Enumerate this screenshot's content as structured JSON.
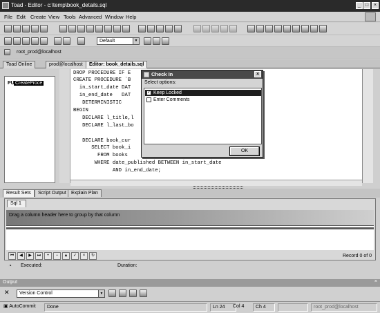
{
  "window": {
    "title": "Toad - Editor - c:\\temp\\book_details.sql",
    "controls": [
      "_",
      "□",
      "×"
    ]
  },
  "menu": {
    "items": [
      "File",
      "Edit",
      "Create",
      "View",
      "Tools",
      "Advanced",
      "Window",
      "Help"
    ],
    "mdi_controls": [
      "_",
      "□",
      "×"
    ]
  },
  "toolbar": {
    "combo_value": "Default"
  },
  "connection": {
    "label": "root_prod@localhost"
  },
  "tabs": [
    "Toad Online",
    "prod@localhost",
    "Editor: book_details.sql"
  ],
  "tree": {
    "prefix": "PU",
    "node_label": "CreateProce"
  },
  "editor": {
    "lines": [
      "DROP PROCEDURE IF E",
      "CREATE PROCEDURE `B",
      "  in_start_date DAT",
      "  in_end_date   DAT",
      "   DETERMINISTIC",
      "BEGIN",
      "   DECLARE l_title,l",
      "   DECLARE l_last_bo",
      "",
      "   DECLARE book_cur ",
      "      SELECT book_i",
      "        FROM books",
      "       WHERE date_published BETWEEN in_start_date",
      "             AND in_end_date;"
    ]
  },
  "dialog": {
    "title": "Check In",
    "subtitle": "Select options:",
    "options": [
      {
        "label": "Keep Locked",
        "checked": true,
        "selected": true
      },
      {
        "label": "Enter Comments",
        "checked": false,
        "selected": false
      }
    ],
    "ok_label": "OK"
  },
  "results": {
    "tabs": [
      "Result Sets",
      "Script Output",
      "Explain Plan"
    ],
    "sql_tab": "Sql 1",
    "group_hint": "Drag a column header here to group by that column",
    "record_info": "Record 0 of 0",
    "executed_label": "Executed:",
    "duration_label": "Duration:"
  },
  "nav_buttons": [
    "⏮",
    "◀",
    "▶",
    "⏭",
    "+",
    "−",
    "▲",
    "✓",
    "×",
    "↻"
  ],
  "output": {
    "header": "Output",
    "combo_value": "Version Control"
  },
  "status": {
    "autocommit": "AutoCommit",
    "state": "Done",
    "line": "Ln 24",
    "col": "Col 4",
    "ch": "Ch 4",
    "connection": "root_prod@localhost"
  },
  "colors": {
    "titlebar": "#2a2a2a",
    "selection": "#1e1e1e",
    "keyword": "#555555"
  },
  "icons": [
    "toad-app-icon",
    "folder-open-icon",
    "save-icon",
    "print-icon",
    "check-in-icon",
    "check-out-icon",
    "database-icon"
  ]
}
